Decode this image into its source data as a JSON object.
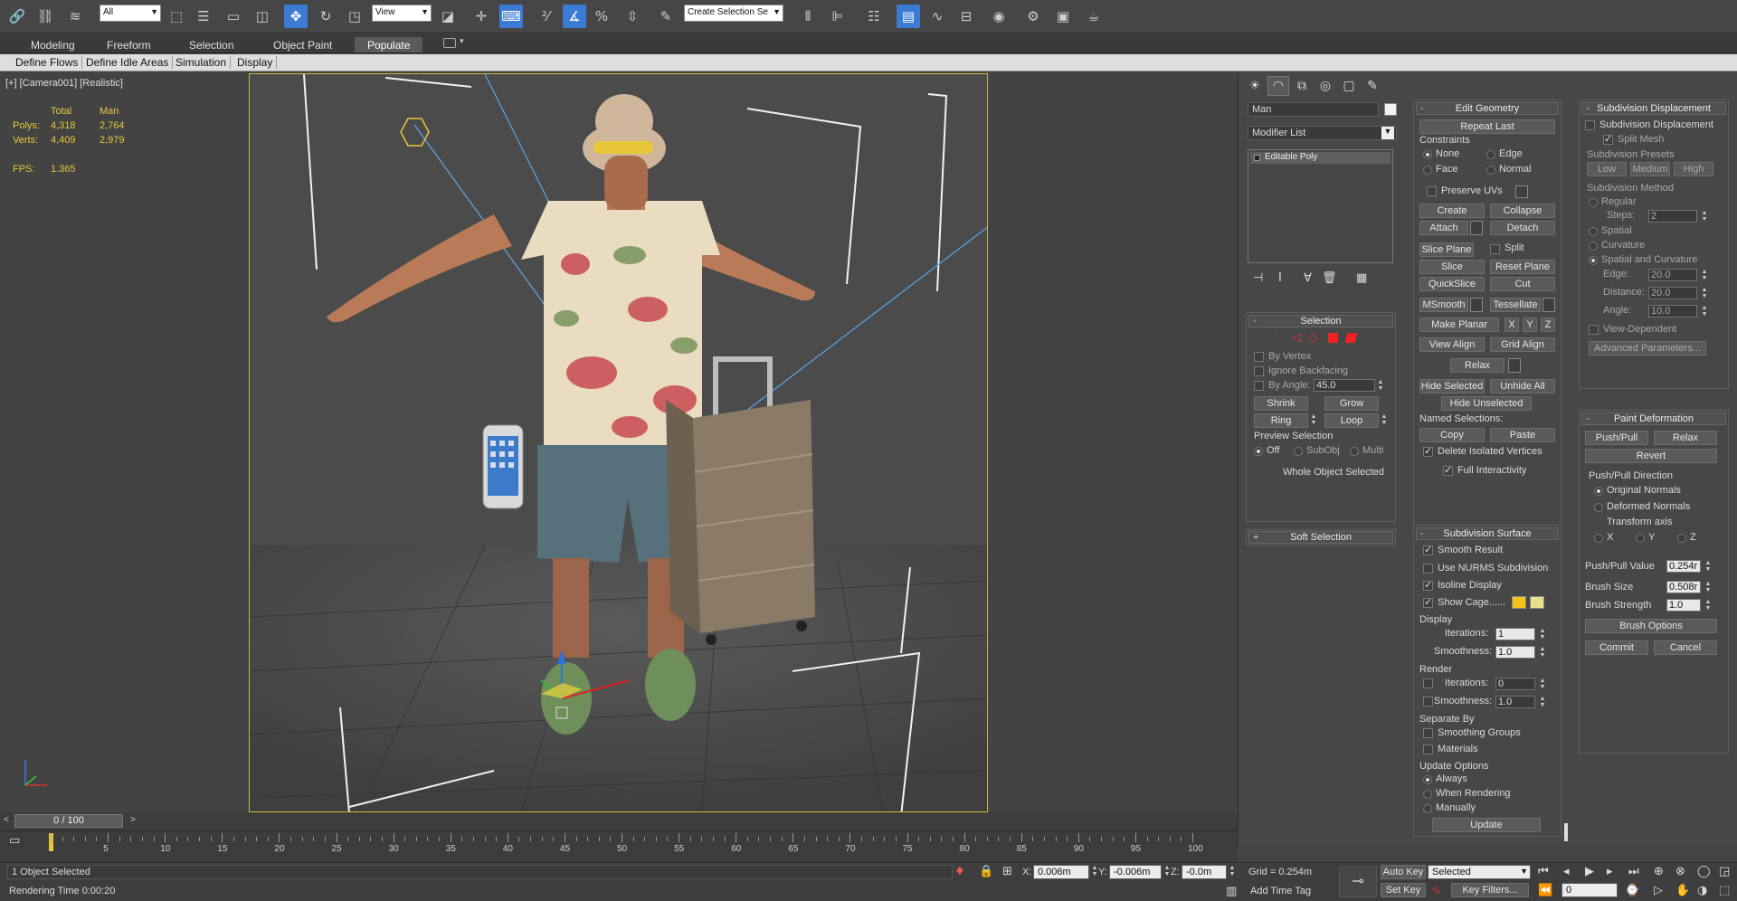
{
  "toolbar": {
    "selection_filter": "All",
    "ref_coord": "View",
    "named_selection_placeholder": "Create Selection Se"
  },
  "ribbon": {
    "tabs": [
      "Modeling",
      "Freeform",
      "Selection",
      "Object Paint",
      "Populate"
    ],
    "active_tab": "Populate",
    "subtabs": [
      "Define Flows",
      "Define Idle Areas",
      "Simulation",
      "Display"
    ]
  },
  "viewport": {
    "label": "[+] [Camera001] [Realistic]",
    "stats": {
      "col_total": "Total",
      "col_man": "Man",
      "polys_label": "Polys:",
      "polys_total": "4,318",
      "polys_man": "2,764",
      "verts_label": "Verts:",
      "verts_total": "4,409",
      "verts_man": "2,979",
      "fps_label": "FPS:",
      "fps_value": "1.365"
    }
  },
  "command_panel": {
    "object_name": "Man",
    "modifier_list": "Modifier List",
    "stack_items": [
      "Editable Poly"
    ],
    "selection": {
      "title": "Selection",
      "by_vertex": "By Vertex",
      "ignore_backfacing": "Ignore Backfacing",
      "by_angle": "By Angle:",
      "by_angle_value": "45.0",
      "shrink": "Shrink",
      "grow": "Grow",
      "ring": "Ring",
      "loop": "Loop",
      "preview_selection": "Preview Selection",
      "preview_off": "Off",
      "preview_subobj": "SubObj",
      "preview_multi": "Multi",
      "whole_object": "Whole Object Selected"
    },
    "soft_selection": {
      "title": "Soft Selection"
    },
    "edit_geometry": {
      "title": "Edit Geometry",
      "repeat_last": "Repeat Last",
      "constraints": "Constraints",
      "none": "None",
      "edge": "Edge",
      "face": "Face",
      "normal": "Normal",
      "preserve_uvs": "Preserve UVs",
      "create": "Create",
      "collapse": "Collapse",
      "attach": "Attach",
      "detach": "Detach",
      "slice_plane": "Slice Plane",
      "split": "Split",
      "slice": "Slice",
      "reset_plane": "Reset Plane",
      "quickslice": "QuickSlice",
      "cut": "Cut",
      "msmooth": "MSmooth",
      "tessellate": "Tessellate",
      "make_planar": "Make Planar",
      "x": "X",
      "y": "Y",
      "z": "Z",
      "view_align": "View Align",
      "grid_align": "Grid Align",
      "relax": "Relax",
      "hide_selected": "Hide Selected",
      "unhide_all": "Unhide All",
      "hide_unselected": "Hide Unselected",
      "named_selections": "Named Selections:",
      "copy": "Copy",
      "paste": "Paste",
      "delete_isolated": "Delete Isolated Vertices",
      "full_interactivity": "Full Interactivity"
    },
    "subdivision_surface": {
      "title": "Subdivision Surface",
      "smooth_result": "Smooth Result",
      "use_nurms": "Use NURMS Subdivision",
      "isoline_display": "Isoline Display",
      "show_cage": "Show Cage......",
      "display": "Display",
      "iterations_label": "Iterations:",
      "display_iterations": "1",
      "smoothness_label": "Smoothness:",
      "display_smoothness": "1.0",
      "render": "Render",
      "render_iterations": "0",
      "render_smoothness": "1.0",
      "separate_by": "Separate By",
      "smoothing_groups": "Smoothing Groups",
      "materials": "Materials",
      "update_options": "Update Options",
      "always": "Always",
      "when_rendering": "When Rendering",
      "manually": "Manually",
      "update": "Update",
      "cage_color_1": "#f2c31a",
      "cage_color_2": "#e8e08a"
    },
    "subdivision_displacement": {
      "title": "Subdivision Displacement",
      "checkbox": "Subdivision Displacement",
      "split_mesh": "Split Mesh",
      "presets": "Subdivision Presets",
      "low": "Low",
      "medium": "Medium",
      "high": "High",
      "method": "Subdivision Method",
      "regular": "Regular",
      "steps": "Steps:",
      "steps_value": "2",
      "spatial": "Spatial",
      "curvature": "Curvature",
      "spatial_curvature": "Spatial and Curvature",
      "edge": "Edge:",
      "edge_value": "20.0",
      "distance": "Distance:",
      "distance_value": "20.0",
      "angle": "Angle:",
      "angle_value": "10.0",
      "view_dependent": "View-Dependent",
      "advanced": "Advanced Parameters..."
    },
    "paint_deformation": {
      "title": "Paint Deformation",
      "push_pull": "Push/Pull",
      "relax": "Relax",
      "revert": "Revert",
      "direction": "Push/Pull Direction",
      "original_normals": "Original Normals",
      "deformed_normals": "Deformed Normals",
      "transform_axis": "Transform axis",
      "x": "X",
      "y": "Y",
      "z": "Z",
      "push_pull_value": "Push/Pull Value",
      "push_pull_value_v": "0.254r",
      "brush_size": "Brush Size",
      "brush_size_v": "0.508r",
      "brush_strength": "Brush Strength",
      "brush_strength_v": "1.0",
      "brush_options": "Brush Options",
      "commit": "Commit",
      "cancel": "Cancel"
    }
  },
  "timeline": {
    "frame": "0 / 100",
    "ticks": [
      "5",
      "10",
      "15",
      "20",
      "25",
      "30",
      "35",
      "40",
      "45",
      "50",
      "55",
      "60",
      "65",
      "70",
      "75",
      "80",
      "85",
      "90",
      "95",
      "100"
    ]
  },
  "status": {
    "selected": "1 Object Selected",
    "rendering_time": "Rendering Time  0:00:20",
    "x_label": "X:",
    "x": "0.006m",
    "y_label": "Y:",
    "y": "-0.006m",
    "z_label": "Z:",
    "z": "-0.0m",
    "grid": "Grid = 0.254m",
    "add_time_tag": "Add Time Tag",
    "auto_key": "Auto Key",
    "set_key": "Set Key",
    "selected_set": "Selected",
    "key_filters": "Key Filters...",
    "current_frame": "0"
  }
}
